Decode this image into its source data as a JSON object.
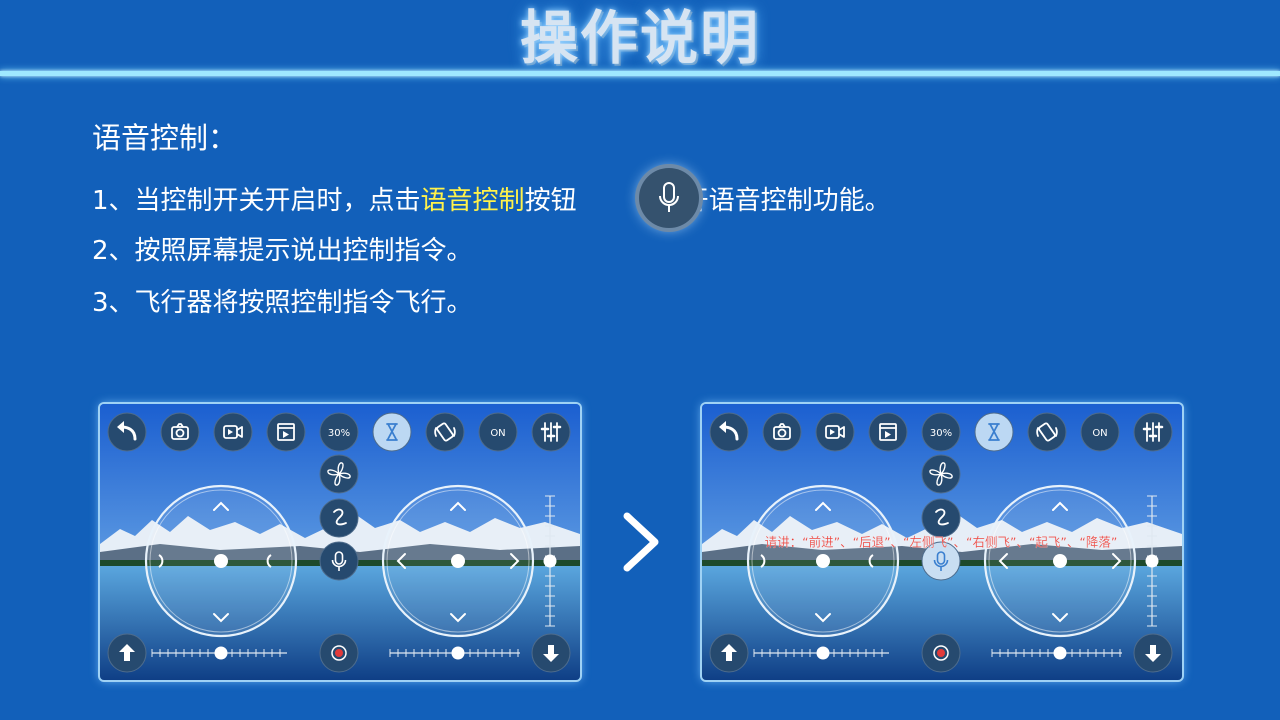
{
  "page": {
    "title": "操作说明",
    "heading": "语音控制：",
    "line1": {
      "before": "1、当控制开关开启时，点击",
      "highlight": "语音控制",
      "after": "按钮",
      "tail": "打开语音控制功能。"
    },
    "line2": "2、按照屏幕提示说出控制指令。",
    "line3": "3、飞行器将按照控制指令飞行。"
  },
  "colors": {
    "background": "#1260ba",
    "highlight": "#fff24a",
    "prompt_text": "#e8302a"
  },
  "panels": [
    {
      "toolbar": [
        "back-icon",
        "camera-icon",
        "video-icon",
        "media-icon",
        "30%",
        "hourglass-icon",
        "rotate-icon",
        "ON",
        "sliders-icon"
      ],
      "speed_label": "30%",
      "switch_label": "ON",
      "mic_state": "inactive",
      "prompt": ""
    },
    {
      "toolbar": [
        "back-icon",
        "camera-icon",
        "video-icon",
        "media-icon",
        "30%",
        "hourglass-icon",
        "rotate-icon",
        "ON",
        "sliders-icon"
      ],
      "speed_label": "30%",
      "switch_label": "ON",
      "mic_state": "active",
      "prompt": "请讲：“前进”、“后退”、“左侧飞”、“右侧飞”、“起飞”、“降落”"
    }
  ]
}
